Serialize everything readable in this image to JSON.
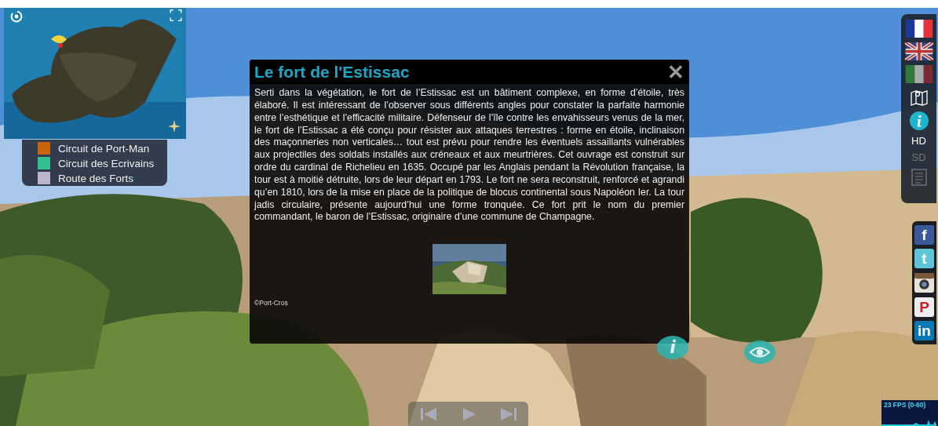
{
  "minimap": {
    "legend": [
      {
        "label": "Circuit de Port-Man",
        "color": "#c8650c"
      },
      {
        "label": "Circuit des Ecrivains",
        "color": "#2fbf90"
      },
      {
        "label": "Route des Forts",
        "color": "#bcb3cf"
      }
    ]
  },
  "popup": {
    "title": "Le fort de l'Estissac",
    "close": "✕",
    "body": "Serti dans la végétation, le fort de l’Estissac est un bâtiment complexe, en forme d’étoile, très élaboré. Il est intéressant de l’observer sous différents angles pour constater la parfaite harmonie entre l’esthétique et l’efficacité militaire. Défenseur de l’île contre les envahisseurs venus de la mer, le fort de l’Estissac a été conçu pour résister aux attaques terrestres : forme en étoile, inclinaison des maçonneries non verticales… tout est prévu pour rendre les éventuels assaillants vulnérables aux projectiles des soldats installés aux créneaux et aux meurtrières. Cet ouvrage est construit sur ordre du cardinal de Richelieu en 1635. Occupé par les Anglais pendant la Révolution française, la tour est à moitié détruite, lors de leur départ en 1793. Le fort ne sera reconstruit, renforcé et agrandi qu’en 1810, lors de la mise en place de la politique de blocus continental sous Napoléon Ier. La tour jadis circulaire, présente aujourd’hui une forme tronquée. Ce fort prit le nom du premier commandant, le baron de l’Estissac, originaire d’une commune de Champagne.",
    "credit": "©Port-Cros"
  },
  "sidebar": {
    "quality": [
      {
        "label": "HD",
        "selected": true
      },
      {
        "label": "SD",
        "selected": false
      }
    ]
  },
  "social": [
    {
      "kind": "facebook",
      "glyph": "f"
    },
    {
      "kind": "twitter",
      "glyph": "t"
    },
    {
      "kind": "instagram"
    },
    {
      "kind": "pinterest",
      "glyph": "P"
    },
    {
      "kind": "linkedin",
      "glyph": "in"
    }
  ],
  "fps": {
    "label": "23 FPS (0-60)"
  }
}
